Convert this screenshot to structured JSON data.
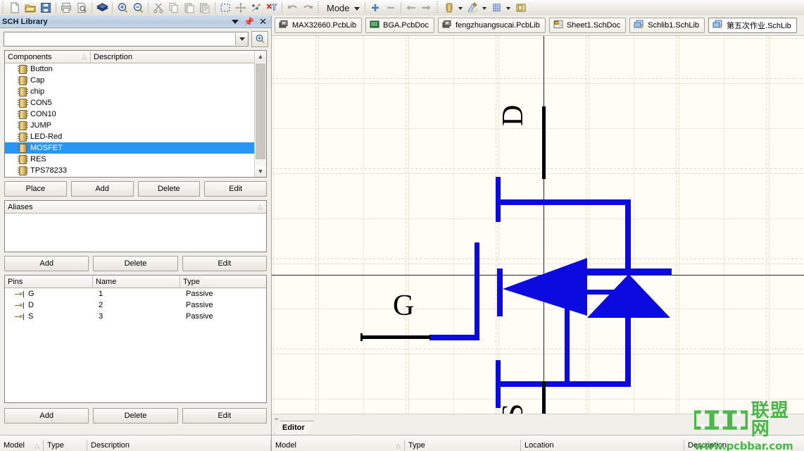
{
  "toolbar": {
    "mode_label": "Mode",
    "icons": [
      "new-file-icon",
      "open-folder-icon",
      "save-icon",
      "print-icon",
      "print-preview-icon",
      "board-icon",
      "zoom-in-icon",
      "zoom-out-icon",
      "cut-icon",
      "copy-icon",
      "paste-icon",
      "paste-special-icon",
      "select-area-icon",
      "move-icon",
      "clear-filter-icon",
      "delete-filter-icon",
      "undo-icon",
      "redo-icon",
      "plus-icon",
      "minus-icon",
      "back-arrow-icon",
      "forward-arrow-icon",
      "component-icon",
      "draw-tools-icon",
      "grid-icon",
      "library-icon"
    ]
  },
  "panel": {
    "title": "SCH Library",
    "header_buttons": [
      "chevron-down-icon",
      "pin-icon",
      "close-icon"
    ],
    "search": {
      "value": "",
      "placeholder": ""
    },
    "components": {
      "columns": [
        "Components",
        "Description"
      ],
      "items": [
        {
          "name": "Button",
          "description": ""
        },
        {
          "name": "Cap",
          "description": ""
        },
        {
          "name": "chip",
          "description": ""
        },
        {
          "name": "CON5",
          "description": ""
        },
        {
          "name": "CON10",
          "description": ""
        },
        {
          "name": "JUMP",
          "description": ""
        },
        {
          "name": "LED-Red",
          "description": ""
        },
        {
          "name": "MOSFET",
          "description": "",
          "selected": true
        },
        {
          "name": "RES",
          "description": ""
        },
        {
          "name": "TPS78233",
          "description": ""
        }
      ],
      "buttons": [
        "Place",
        "Add",
        "Delete",
        "Edit"
      ]
    },
    "aliases": {
      "columns": [
        "Aliases"
      ],
      "items": [],
      "buttons": [
        "Add",
        "Delete",
        "Edit"
      ]
    },
    "pins": {
      "columns": [
        "Pins",
        "Name",
        "Type"
      ],
      "rows": [
        {
          "pin": "G",
          "name": "1",
          "type": "Passive"
        },
        {
          "pin": "D",
          "name": "2",
          "type": "Passive"
        },
        {
          "pin": "S",
          "name": "3",
          "type": "Passive"
        }
      ],
      "buttons": [
        "Add",
        "Delete",
        "Edit"
      ]
    },
    "model_header": {
      "columns": [
        "Model",
        "Type",
        "Description"
      ]
    }
  },
  "documents": {
    "tabs": [
      {
        "label": "MAX32660.PcbLib",
        "icon": "pcblib-icon",
        "active": false
      },
      {
        "label": "BGA.PcbDoc",
        "icon": "pcbdoc-icon",
        "active": false
      },
      {
        "label": "fengzhuangsucai.PcbLib",
        "icon": "pcblib-icon",
        "active": false
      },
      {
        "label": "Sheet1.SchDoc",
        "icon": "schdoc-icon",
        "active": false
      },
      {
        "label": "Schlib1.SchLib",
        "icon": "schlib-icon",
        "active": false
      },
      {
        "label": "第五次作业.SchLib",
        "icon": "schlib-icon",
        "active": true
      }
    ]
  },
  "schematic": {
    "component": "MOSFET",
    "pin_labels": {
      "drain": "D",
      "gate": "G",
      "source": "S"
    },
    "annotation": {
      "type": "arrow",
      "color": "#f9453f",
      "points_to": "drain-pin"
    },
    "colors": {
      "wire": "#0b0be0",
      "pin": "#000000",
      "background": "#fffdf5"
    }
  },
  "editor": {
    "tab_label": "Editor",
    "model_columns": [
      "Model",
      "Type",
      "Location",
      "Description"
    ],
    "collapse_icon": "double-chevron-left-icon"
  },
  "watermark": {
    "brand_letters": [
      "p",
      "c",
      "b"
    ],
    "brand_cn": "联盟网",
    "url": "www.pcbbar.com",
    "color": "#49b749"
  }
}
